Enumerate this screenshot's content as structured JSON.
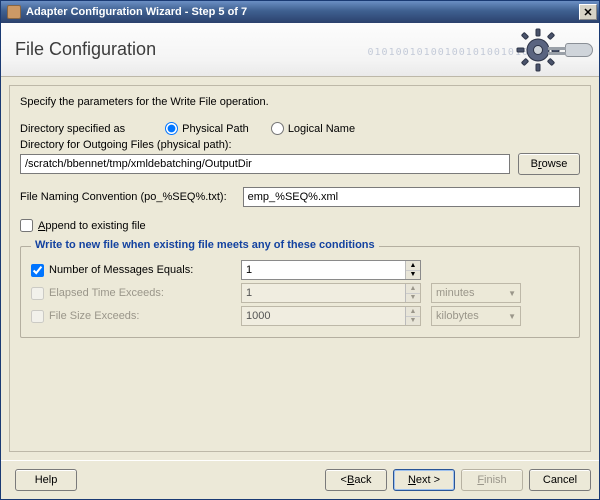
{
  "window": {
    "title": "Adapter Configuration Wizard - Step 5 of 7",
    "close_glyph": "✕"
  },
  "header": {
    "title": "File Configuration",
    "bg_digits": "01010010100100101001010"
  },
  "panel": {
    "description": "Specify the parameters for the Write File operation.",
    "dir_specified_label": "Directory specified as",
    "radio_physical": "Physical Path",
    "radio_logical": "Logical Name",
    "dir_specified_selected": "physical",
    "dir_outgoing_label": "Directory for Outgoing Files (physical path):",
    "dir_outgoing_value": "/scratch/bbennet/tmp/xmldebatching/OutputDir",
    "browse_label": "Browse",
    "naming_label": "File Naming Convention (po_%SEQ%.txt):",
    "naming_value": "emp_%SEQ%.xml",
    "append_label": "Append to existing file",
    "append_checked": false
  },
  "conditions": {
    "legend": "Write to new file when existing file meets any of these conditions",
    "rows": [
      {
        "label": "Number of Messages Equals:",
        "checked": true,
        "enabled": true,
        "value": "1",
        "unit": null
      },
      {
        "label": "Elapsed Time Exceeds:",
        "checked": false,
        "enabled": false,
        "value": "1",
        "unit": "minutes"
      },
      {
        "label": "File Size Exceeds:",
        "checked": false,
        "enabled": false,
        "value": "1000",
        "unit": "kilobytes"
      }
    ]
  },
  "footer": {
    "help": "Help",
    "back": "< Back",
    "next": "Next >",
    "finish": "Finish",
    "cancel": "Cancel"
  }
}
